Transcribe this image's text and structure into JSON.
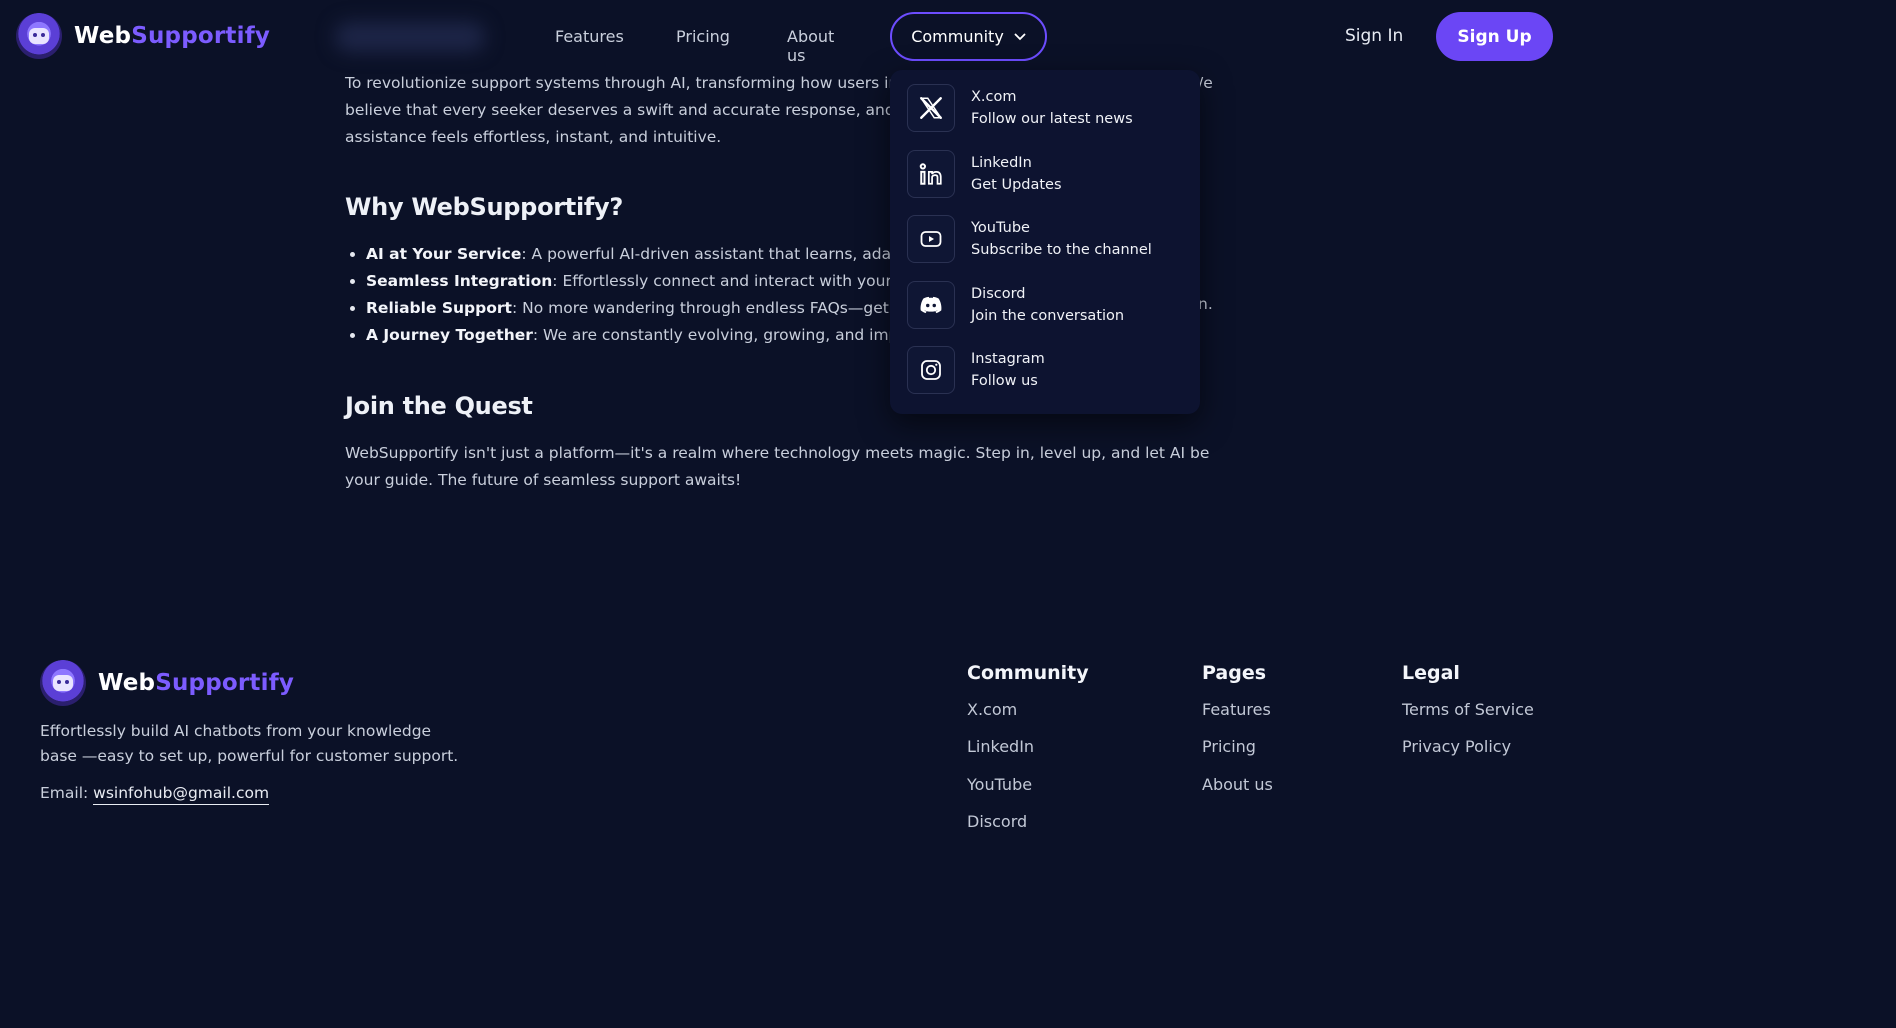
{
  "brand": {
    "name_part1": "Web",
    "name_part2": "Supportify"
  },
  "nav": {
    "features": "Features",
    "pricing": "Pricing",
    "about": "About us",
    "community": "Community",
    "signin": "Sign In",
    "signup": "Sign Up"
  },
  "content": {
    "intro_line1": "To revolutionize support systems through AI, transforming how users int",
    "intro_line2": "believe that every seeker deserves a swift and accurate response, and w",
    "intro_line3": "assistance feels effortless, instant, and intuitive.",
    "intro_right_fragment": "/e",
    "why_title": "Why WebSupportify?",
    "bullets": [
      {
        "bold": "AI at Your Service",
        "text": ": A powerful AI-driven assistant that learns, adapts,"
      },
      {
        "bold": "Seamless Integration",
        "text": ": Effortlessly connect and interact with your data"
      },
      {
        "bold": "Reliable Support",
        "text": ": No more wandering through endless FAQs—get th"
      },
      {
        "bold": "A Journey Together",
        "text": ": We are constantly evolving, growing, and impro"
      }
    ],
    "bullet3_tail": "n.",
    "quest_title": "Join the Quest",
    "quest_text": "WebSupportify isn't just a platform—it's a realm where technology meets magic. Step in, level up, and let AI be your guide. The future of seamless support awaits!"
  },
  "dropdown": [
    {
      "icon": "x-icon",
      "title": "X.com",
      "sub": "Follow our latest news"
    },
    {
      "icon": "linkedin-icon",
      "title": "LinkedIn",
      "sub": "Get Updates"
    },
    {
      "icon": "youtube-icon",
      "title": "YouTube",
      "sub": "Subscribe to the channel"
    },
    {
      "icon": "discord-icon",
      "title": "Discord",
      "sub": "Join the conversation"
    },
    {
      "icon": "instagram-icon",
      "title": "Instagram",
      "sub": "Follow us"
    }
  ],
  "footer": {
    "desc": "Effortlessly build AI chatbots from your knowledge base —easy to set up, powerful for customer support.",
    "email_label": "Email: ",
    "email": "wsinfohub@gmail.com",
    "columns": [
      {
        "title": "Community",
        "items": [
          "X.com",
          "LinkedIn",
          "YouTube",
          "Discord"
        ]
      },
      {
        "title": "Pages",
        "items": [
          "Features",
          "Pricing",
          "About us"
        ]
      },
      {
        "title": "Legal",
        "items": [
          "Terms of Service",
          "Privacy Policy"
        ]
      }
    ]
  },
  "colors": {
    "background": "#0b1127",
    "accent": "#6b46f5",
    "brand_purple": "#7c5cff"
  }
}
